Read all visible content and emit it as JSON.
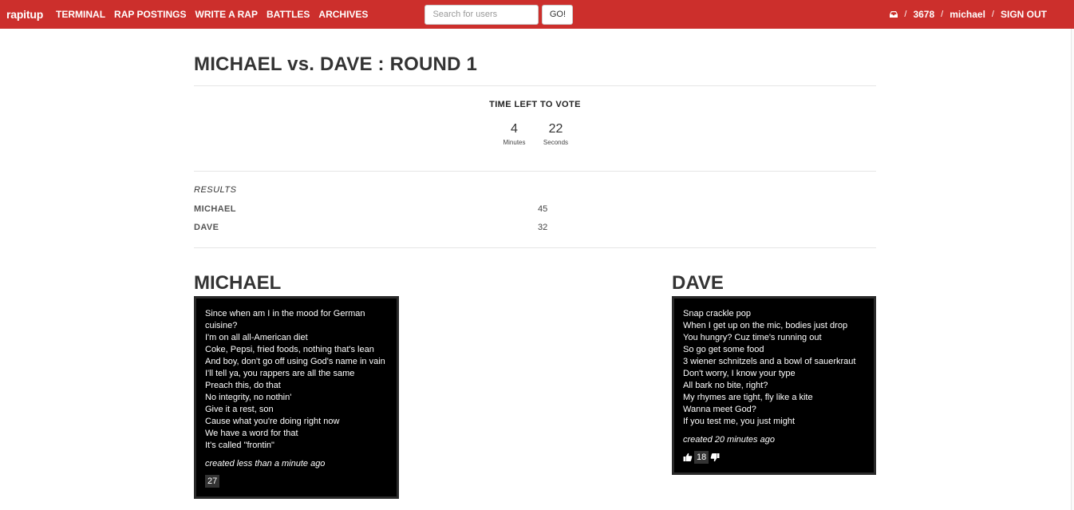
{
  "colors": {
    "brand": "#cc2f2c"
  },
  "navbar": {
    "brand": "rapitup",
    "links": [
      "TERMINAL",
      "RAP POSTINGS",
      "WRITE A RAP",
      "BATTLES",
      "ARCHIVES"
    ],
    "search": {
      "placeholder": "Search for users",
      "value": ""
    },
    "go_label": "GO!",
    "inbox_icon": "inbox-icon",
    "points": "3678",
    "separator": "/",
    "username": "michael",
    "sign_out": "SIGN OUT"
  },
  "battle": {
    "title": "MICHAEL vs. DAVE : ROUND 1",
    "timer": {
      "heading": "TIME LEFT TO VOTE",
      "minutes": "4",
      "minutes_label": "Minutes",
      "seconds": "22",
      "seconds_label": "Seconds"
    },
    "results": {
      "heading": "RESULTS",
      "rows": [
        {
          "name": "MICHAEL",
          "votes": "45"
        },
        {
          "name": "DAVE",
          "votes": "32"
        }
      ]
    }
  },
  "raps": [
    {
      "rapper": "MICHAEL",
      "lines": [
        "Since when am I in the mood for German cuisine?",
        "I'm on all all-American diet",
        "Coke, Pepsi, fried foods, nothing that's lean",
        "And boy, don't go off using God's name in vain",
        "I'll tell ya, you rappers are all the same",
        "Preach this, do that",
        "No integrity, no nothin'",
        "Give it a rest, son",
        "Cause what you're doing right now",
        "We have a word for that",
        "It's called \"frontin\""
      ],
      "created": "created less than a minute ago",
      "votes": "27"
    },
    {
      "rapper": "DAVE",
      "lines": [
        "Snap crackle pop",
        "When I get up on the mic, bodies just drop",
        "You hungry? Cuz time's running out",
        "So go get some food",
        "3 wiener schnitzels and a bowl of sauerkraut",
        "Don't worry, I know your type",
        "All bark no bite, right?",
        "My rhymes are tight, fly like a kite",
        "Wanna meet God?",
        "If you test me, you just might"
      ],
      "created": "created 20 minutes ago",
      "votes": "18",
      "icons": [
        "thumbs-up-icon",
        "thumbs-down-icon"
      ]
    }
  ]
}
